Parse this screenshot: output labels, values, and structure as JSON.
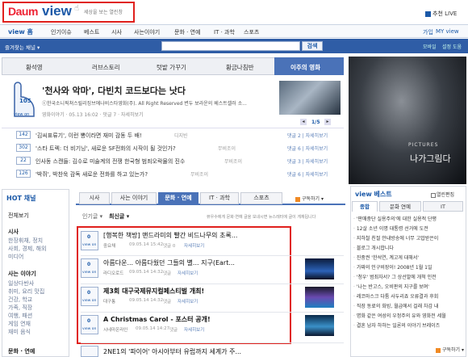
{
  "brand": {
    "logo": "Daum",
    "product": "view",
    "tagline": "세상을 보는 열린창"
  },
  "top_right": {
    "recommend": "추천 LIVE"
  },
  "nav": {
    "items": [
      "view 홈",
      "인기이슈",
      "베스트",
      "시사",
      "사는이야기",
      "문화 · 연예",
      "IT · 과학",
      "스포츠"
    ],
    "right": {
      "join": "가입",
      "my_view": "MY view"
    }
  },
  "search": {
    "bookmark": "즐겨찾는 채널",
    "value": "",
    "button": "검색",
    "right": [
      "모바일",
      "설정 도움"
    ]
  },
  "feature_tabs": [
    "황석영",
    "러브스토리",
    "텃밭 가꾸기",
    "황금나침반",
    "이주의 영화"
  ],
  "featured": {
    "count": "105",
    "count_label": "view on",
    "title": "'천사와 악마', 다빈치 코드보다는 낫다",
    "desc": "ⓒ한국소니픽쳐스릴리징브에나비스타영화(주). All Right Reserved 변두 보라운의 베스트셀러 소...",
    "meta": "영화이야기 · 05.13 16:02 · 댓글 7 · 자세히보기",
    "pager": "1/5"
  },
  "small_list": [
    {
      "count": "142",
      "title": "'김씨표류기', 이런 뽕이라면 재미 감동 두 배!",
      "source": "디지빈",
      "meta": "댓글 2 | 자세히보기"
    },
    {
      "count": "302",
      "title": "'스타 트렉: 더 비기닝', 새로운 SF전화의 시작이 될 것인가?",
      "source": "무비조이",
      "meta": "댓글 6 | 자세히보기"
    },
    {
      "count": "22",
      "title": "인사동 스캔들: 김수로 미술계의 전쟁 한국형 범죄오락물의 진수",
      "source": "무비조이",
      "meta": "댓글 3 | 자세히보기"
    },
    {
      "count": "126",
      "title": "'박쥐', 박찬욱 감독 새로운 전화를 하고 있는가?",
      "source": "무비조이",
      "meta": "댓글 6 | 자세히보기"
    }
  ],
  "movie_ad": {
    "brand": "PICTURES",
    "title": "나가그림다"
  },
  "hot": {
    "title": "HOT 채널",
    "all": "전체보기",
    "groups": [
      {
        "head": "시사",
        "lines": [
          "한장휘채, 정치",
          "사회, 경제, 해외",
          "미디어"
        ]
      },
      {
        "head": "사는 이야기",
        "lines": [
          "일상다반사",
          "취미, 요리 맛집",
          "건강, 학교",
          "가족, 직장",
          "여행, 패션",
          "게임 연재",
          "재미 음식"
        ]
      },
      {
        "head": "문화 · 연예",
        "lines": []
      }
    ]
  },
  "mid_tabs": [
    "시사",
    "사는 이야기",
    "문화 · 연예",
    "IT · 과학",
    "스포츠"
  ],
  "subscribe": "구독하기",
  "sort": {
    "popular": "인기글",
    "latest": "최신글",
    "notice": "뷰우수에게 문화·연예 글을 보내시면 뉴스레터에 글이 게재됩니다"
  },
  "articles": [
    {
      "count": "0",
      "count_label": "view on",
      "title": "[행복한 책방] 맨드라미의 빨간 비드나무의 초록...",
      "source": "중요채",
      "time": "09.05.14 15:42",
      "comments": "댓글 0",
      "detail": "자세히보기",
      "thumb": false
    },
    {
      "count": "0",
      "count_label": "view on",
      "title": "아름다운... 아름다웠던 그들의 별... 지구(Eart...",
      "source": "라디오로드",
      "time": "09.05.14 14:32",
      "comments": "댓글",
      "detail": "자세히보기",
      "thumb": true
    },
    {
      "count": "0",
      "count_label": "view on",
      "title": "제3회 대구국제뮤지컬페스티벌 개최!",
      "source": "대구통",
      "time": "09.05.14 14:32",
      "comments": "댓글",
      "detail": "자세히보기",
      "thumb": true
    },
    {
      "count": "0",
      "count_label": "view on",
      "title": "A Christmas Carol - 포스터 공개!",
      "source": "시네마온라인",
      "time": "09.05.14 14:27",
      "comments": "댓글",
      "detail": "자세히보기",
      "thumb": true
    }
  ],
  "cut_article": {
    "title": "2NE1의 '파이어' 아시아부터 유럽까지 세계가 주..."
  },
  "best": {
    "title": "view 베스트",
    "opinion": "열린편집",
    "tabs": [
      "종합",
      "문화 연예",
      "IT"
    ],
    "items": [
      "'판매중단 실용주의'에 대한 실용적 단평",
      "12살 소년 이명 대통령 선거에 도전",
      "지하철 친절 안내방송에 너무 고맙받은이",
      "블로그 개시합니다",
      "진중권 '한석연, 계고게 대해서'",
      "가짜의 인구비장이! 2008년 1월 1일",
      "'청우' 범죄자서? 그 상선발에 개척 인전",
      "'나는 반고스, 오비판의 지구를 보며'",
      "레코마스크 다툼 사두리죠 오류결과 후회",
      "직장 동료의 화빙, 월급에서 걸래 차감 내",
      "명화 같은 여성의 우정주의 유와 영화전 세월",
      "결혼 남자 하하는 일론의 이야기 브레이즈"
    ],
    "subscribe": "구독하기"
  },
  "colors": {
    "nav_blue": "#1b59a8",
    "accent_red": "#e0201c",
    "tab_active": "#4a72b8"
  }
}
